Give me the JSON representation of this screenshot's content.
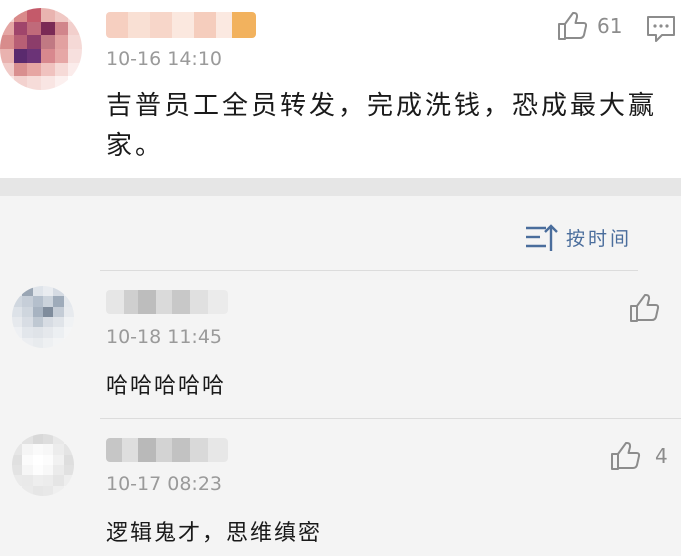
{
  "main_comment": {
    "timestamp": "10-16 14:10",
    "like_count": "61",
    "text": "吉普员工全员转发，完成洗钱，恐成最大赢家。"
  },
  "sort": {
    "label": "按时间"
  },
  "replies": [
    {
      "timestamp": "10-18 11:45",
      "text": "哈哈哈哈哈",
      "like_count": ""
    },
    {
      "timestamp": "10-17 08:23",
      "text": "逻辑鬼才，思维缜密",
      "like_count": "4"
    }
  ],
  "colors": {
    "accent": "#4a6d9c",
    "meta": "#9a9a9a",
    "icon": "#8c8c8c"
  },
  "icons": {
    "like": "thumb-up-icon",
    "comment": "comment-icon",
    "sort": "sort-icon"
  }
}
